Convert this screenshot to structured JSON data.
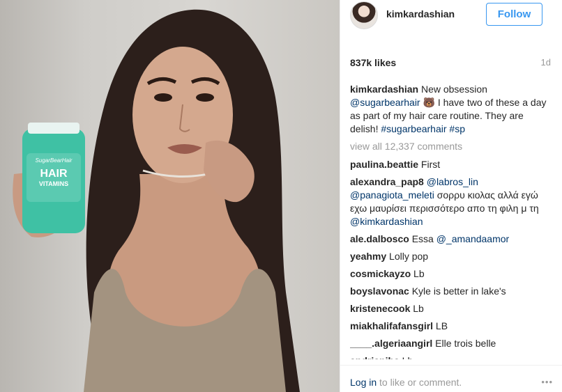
{
  "header": {
    "username": "kimkardashian",
    "follow_label": "Follow"
  },
  "stats": {
    "likes": "837k likes",
    "age": "1d"
  },
  "caption": {
    "user": "kimkardashian",
    "text_1": " New obsession ",
    "mention": "@sugarbearhair",
    "emoji": " 🐻",
    "text_2": " I have two of these a day as part of my hair care routine. They are delish! ",
    "hashtag_1": "#sugarbearhair",
    "hashtag_2": "#sp"
  },
  "view_all": "view all 12,337 comments",
  "comments": [
    {
      "user": "paulina.beattie",
      "text": " First"
    },
    {
      "user": "alexandra_pap8",
      "mention_1": "@labros_lin",
      "mention_2": "@panagiota_meleti",
      "text": " σορρυ κιολας αλλά εγώ εχω μαυρίσει περισσότερο απο τη φιλη μ τη ",
      "mention_3": "@kimkardashian"
    },
    {
      "user": "ale.dalbosco",
      "text": " Essa ",
      "mention": "@_amandaamor"
    },
    {
      "user": "yeahmy",
      "text": " Lolly pop"
    },
    {
      "user": "cosmickayzo",
      "text": " Lb"
    },
    {
      "user": "boyslavonac",
      "text": " Kyle is better in lake's"
    },
    {
      "user": "kristenecook",
      "text": " Lb"
    },
    {
      "user": "miakhalifafansgirl",
      "text": " LB"
    },
    {
      "user": "____.algeriaangirl",
      "text": " Elle trois belle"
    },
    {
      "user": "andrianiba",
      "text": " Lb"
    }
  ],
  "footer": {
    "login_link": "Log in",
    "login_text": " to like or comment.",
    "more_icon": "•••"
  },
  "photo": {
    "bottle_brand": "SugarBearHair",
    "bottle_line_1": "HAIR",
    "bottle_line_2": "VITAMINS"
  },
  "colors": {
    "accent": "#3897f0",
    "link": "#003569",
    "muted": "#999999",
    "bottle": "#3fc1a4"
  }
}
